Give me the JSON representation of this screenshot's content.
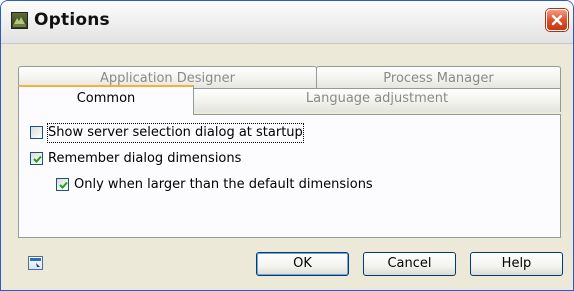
{
  "window": {
    "title": "Options"
  },
  "tabs": {
    "application_designer": "Application Designer",
    "process_manager": "Process Manager",
    "common": "Common",
    "language_adjustment": "Language adjustment"
  },
  "options": [
    {
      "label": "Show server selection dialog at startup",
      "checked": false
    },
    {
      "label": "Remember dialog dimensions",
      "checked": true
    },
    {
      "label": "Only when larger than the default dimensions",
      "checked": true
    }
  ],
  "buttons": {
    "ok": "OK",
    "cancel": "Cancel",
    "help": "Help"
  },
  "icons": {
    "window": "app-icon",
    "close": "close-icon",
    "check": "checkmark-icon",
    "hint": "window-hint-icon"
  },
  "colors": {
    "close_button": "#e0502c",
    "active_tab_accent": "#f7b040",
    "check": "#21a121"
  }
}
